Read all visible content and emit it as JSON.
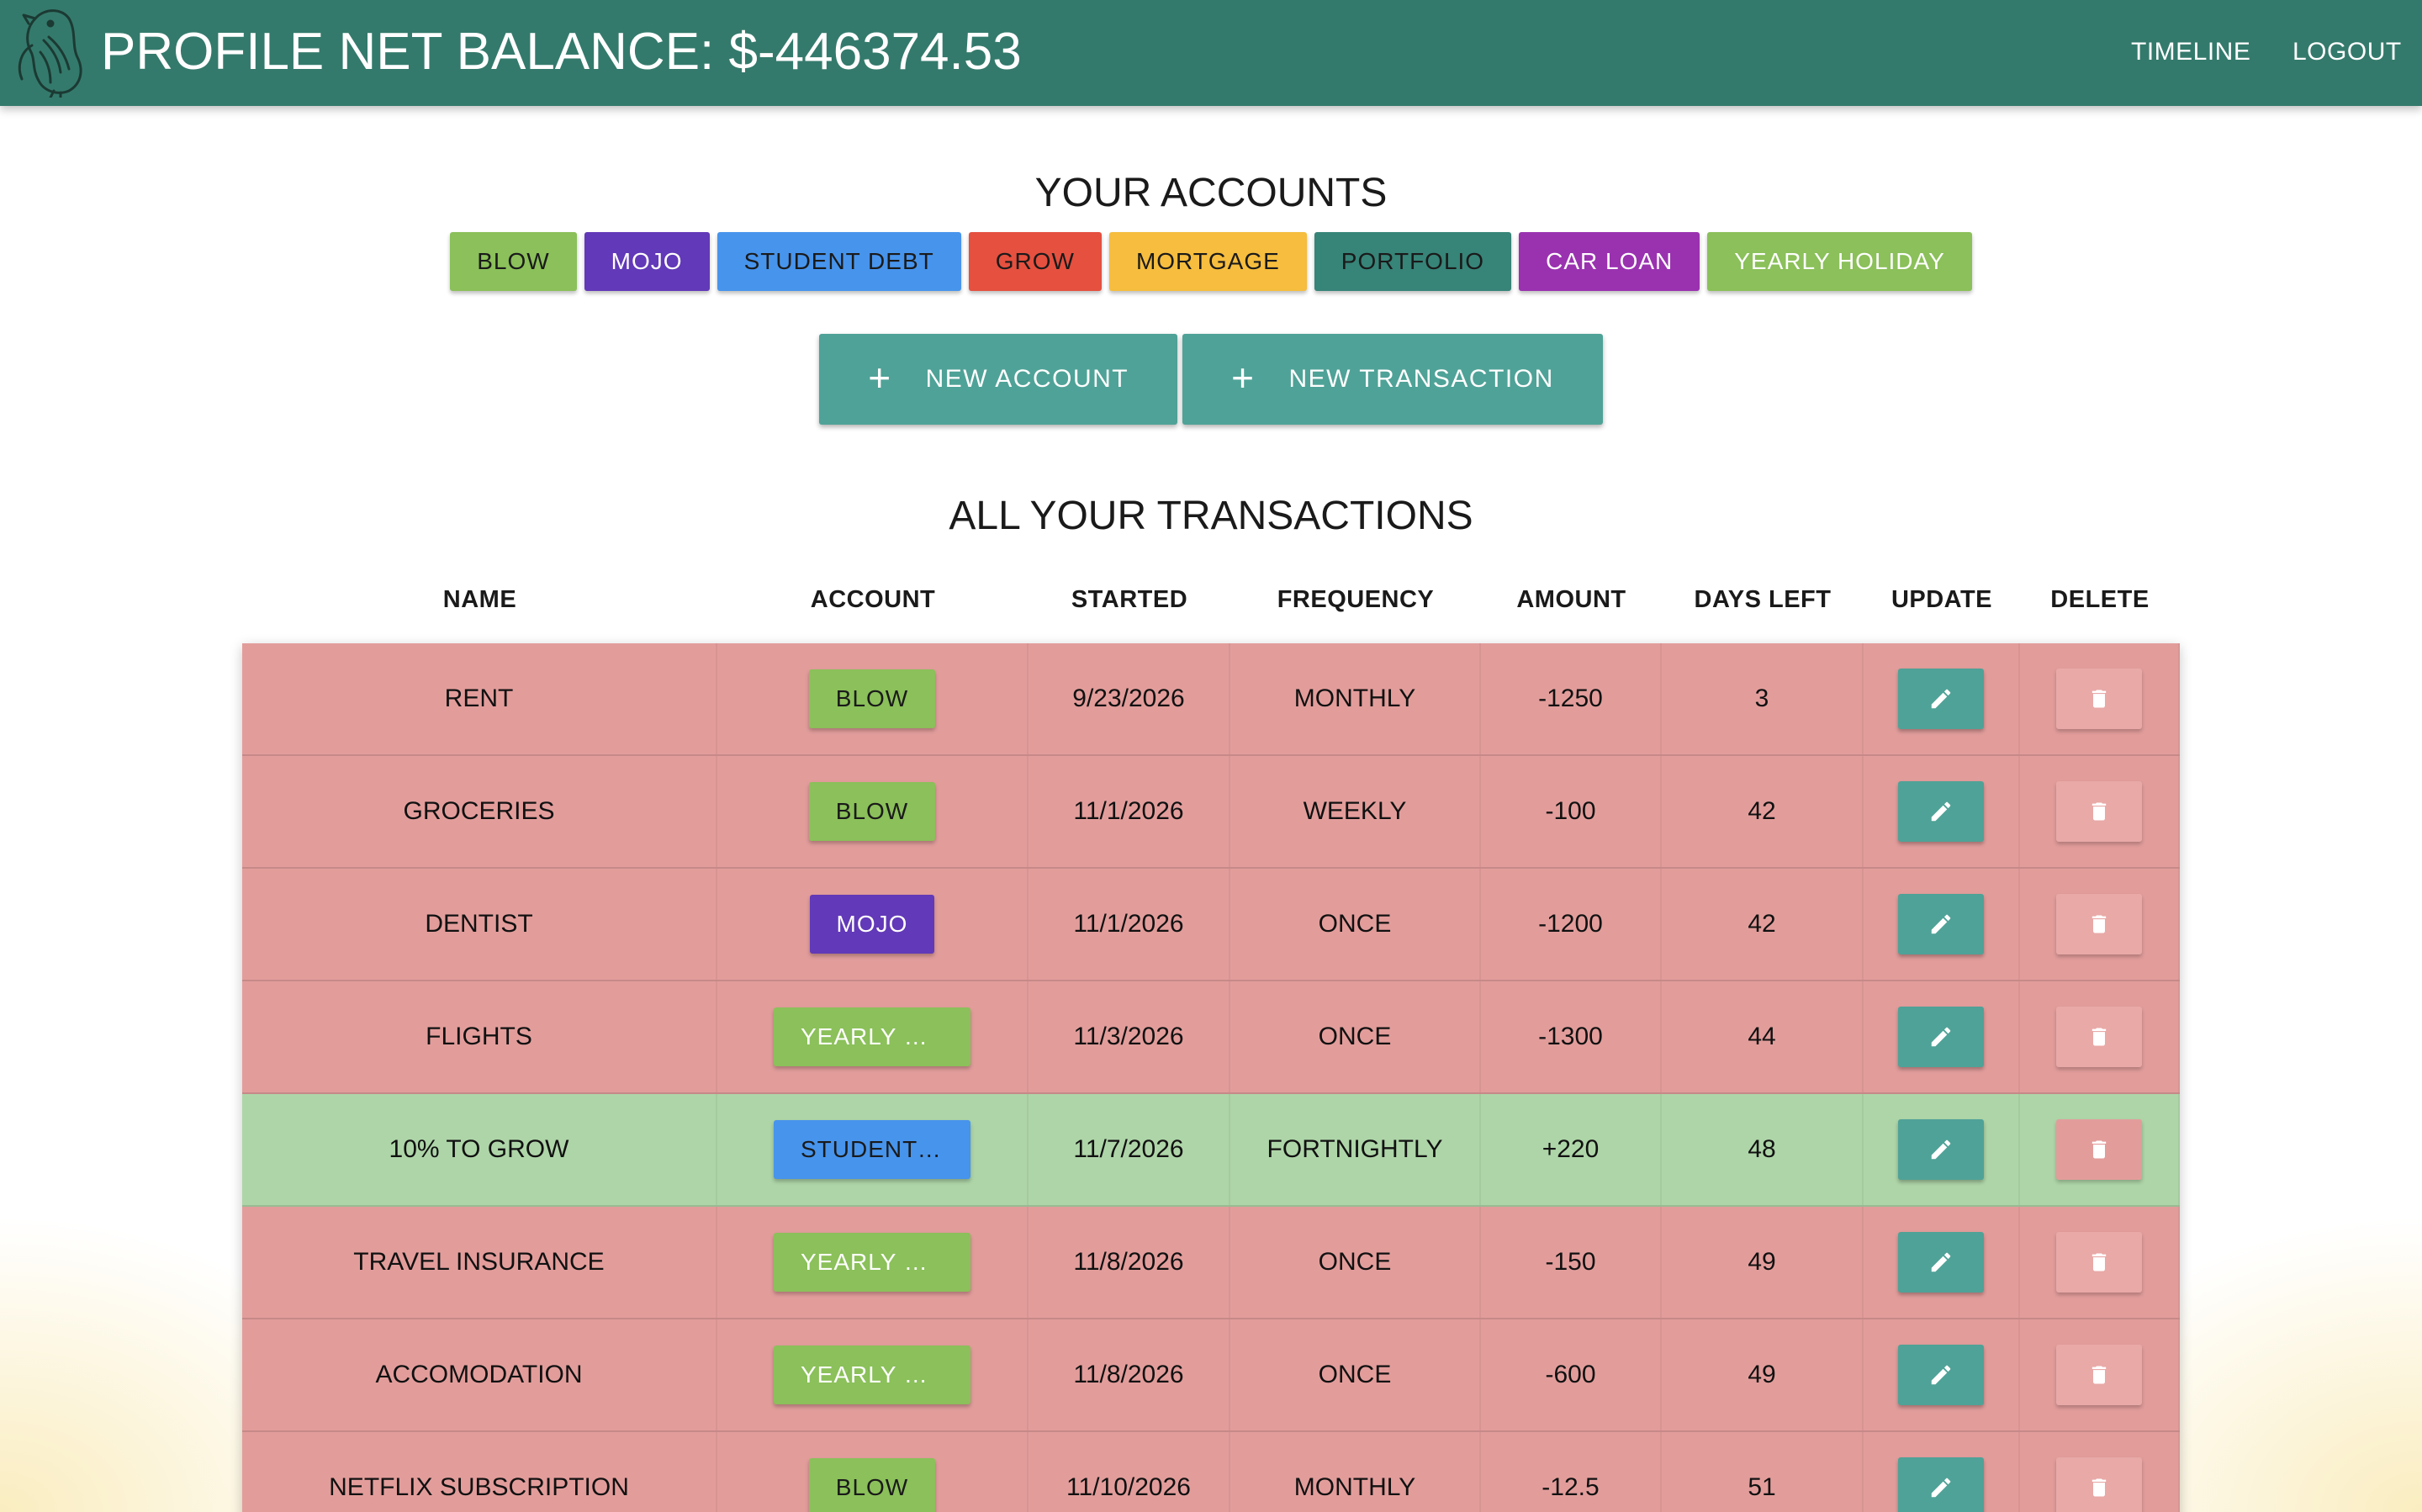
{
  "header": {
    "title": "PROFILE NET BALANCE: $-446374.53",
    "nav": [
      {
        "label": "TIMELINE"
      },
      {
        "label": "LOGOUT"
      }
    ]
  },
  "accounts_section": {
    "title": "YOUR ACCOUNTS",
    "accounts": [
      {
        "label": "BLOW",
        "color": "#8bc05a",
        "text_color": "#1a1a1a"
      },
      {
        "label": "MOJO",
        "color": "#6239b8",
        "text_color": "#ffffff"
      },
      {
        "label": "STUDENT DEBT",
        "color": "#4794ec",
        "text_color": "#1a1a1a"
      },
      {
        "label": "GROW",
        "color": "#e5503f",
        "text_color": "#1a1a1a"
      },
      {
        "label": "MORTGAGE",
        "color": "#f6bd3e",
        "text_color": "#1a1a1a"
      },
      {
        "label": "PORTFOLIO",
        "color": "#378478",
        "text_color": "#1a1a1a"
      },
      {
        "label": "CAR LOAN",
        "color": "#9a32b0",
        "text_color": "#ffffff"
      },
      {
        "label": "YEARLY HOLIDAY",
        "color": "#8bc05a",
        "text_color": "#ffffff"
      }
    ]
  },
  "actions": {
    "new_account_label": "NEW ACCOUNT",
    "new_transaction_label": "NEW TRANSACTION"
  },
  "transactions_section": {
    "title": "ALL YOUR TRANSACTIONS",
    "columns": [
      "NAME",
      "ACCOUNT",
      "STARTED",
      "FREQUENCY",
      "AMOUNT",
      "DAYS LEFT",
      "UPDATE",
      "DELETE"
    ],
    "rows": [
      {
        "name": "RENT",
        "account": "BLOW",
        "account_color": "#8bc05a",
        "account_text_color": "#1a1a1a",
        "started": "9/23/2026",
        "frequency": "MONTHLY",
        "amount": "-1250",
        "days_left": "3",
        "type": "expense"
      },
      {
        "name": "GROCERIES",
        "account": "BLOW",
        "account_color": "#8bc05a",
        "account_text_color": "#1a1a1a",
        "started": "11/1/2026",
        "frequency": "WEEKLY",
        "amount": "-100",
        "days_left": "42",
        "type": "expense"
      },
      {
        "name": "DENTIST",
        "account": "MOJO",
        "account_color": "#6239b8",
        "account_text_color": "#ffffff",
        "started": "11/1/2026",
        "frequency": "ONCE",
        "amount": "-1200",
        "days_left": "42",
        "type": "expense"
      },
      {
        "name": "FLIGHTS",
        "account": "YEARLY H...",
        "account_color": "#8bc05a",
        "account_text_color": "#ffffff",
        "started": "11/3/2026",
        "frequency": "ONCE",
        "amount": "-1300",
        "days_left": "44",
        "type": "expense"
      },
      {
        "name": "10% TO GROW",
        "account": "STUDENT ...",
        "account_color": "#4794ec",
        "account_text_color": "#1a1a1a",
        "started": "11/7/2026",
        "frequency": "FORTNIGHTLY",
        "amount": "+220",
        "days_left": "48",
        "type": "income"
      },
      {
        "name": "TRAVEL INSURANCE",
        "account": "YEARLY H...",
        "account_color": "#8bc05a",
        "account_text_color": "#ffffff",
        "started": "11/8/2026",
        "frequency": "ONCE",
        "amount": "-150",
        "days_left": "49",
        "type": "expense"
      },
      {
        "name": "ACCOMODATION",
        "account": "YEARLY H...",
        "account_color": "#8bc05a",
        "account_text_color": "#ffffff",
        "started": "11/8/2026",
        "frequency": "ONCE",
        "amount": "-600",
        "days_left": "49",
        "type": "expense"
      },
      {
        "name": "NETFLIX SUBSCRIPTION",
        "account": "BLOW",
        "account_color": "#8bc05a",
        "account_text_color": "#1a1a1a",
        "started": "11/10/2026",
        "frequency": "MONTHLY",
        "amount": "-12.5",
        "days_left": "51",
        "type": "expense"
      }
    ]
  },
  "icons": {
    "logo": "bird-logo-icon",
    "add": "plus-icon",
    "edit": "pencil-icon",
    "delete": "trash-icon"
  },
  "colors": {
    "header_bg": "#347a6c",
    "action_bg": "#4fa297",
    "expense_row": "#e29d9b",
    "income_row": "#aed5a8"
  }
}
